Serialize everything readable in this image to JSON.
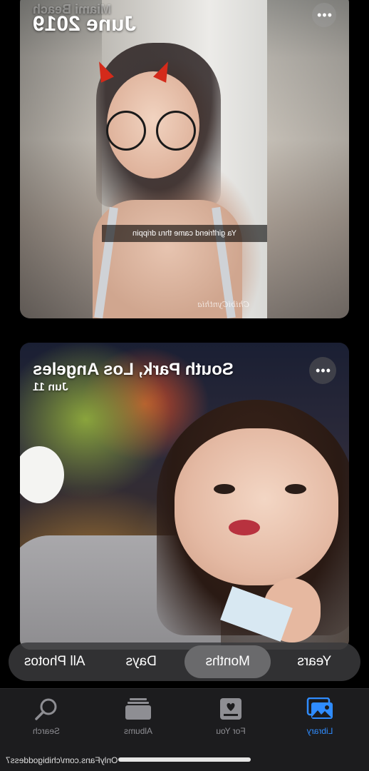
{
  "colors": {
    "accent": "#2f8cff",
    "tab_inactive": "#8e8e93",
    "tabbar_bg": "#1c1c1e",
    "segment_bg": "#3a3a3c"
  },
  "cards": [
    {
      "subtitle": "Miami Beach",
      "title": "June 2019",
      "more_icon": "ellipsis-icon",
      "more_label": "•••",
      "caption": "Ya girlfriend came thru drippin",
      "watermark": "ChibiCynthia"
    },
    {
      "title": "South Park, Los Angeles",
      "subtitle": "Jun 11",
      "more_icon": "ellipsis-icon",
      "more_label": "•••"
    }
  ],
  "segments": {
    "items": [
      "Years",
      "Months",
      "Days",
      "All Photos"
    ],
    "selected": "Months"
  },
  "tabbar": {
    "tabs": [
      {
        "label": "Library",
        "icon": "photo-library-icon",
        "active": true
      },
      {
        "label": "For You",
        "icon": "for-you-icon",
        "active": false
      },
      {
        "label": "Albums",
        "icon": "albums-icon",
        "active": false
      },
      {
        "label": "Search",
        "icon": "search-icon",
        "active": false
      }
    ]
  },
  "footer": {
    "url": "OnlyFans.com/chibigoddess7"
  }
}
